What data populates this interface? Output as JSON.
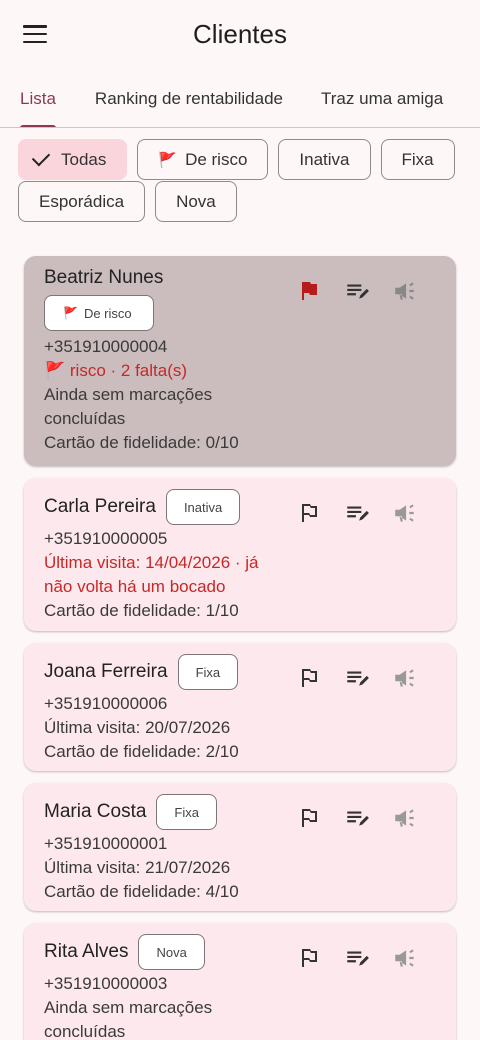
{
  "appbar": {
    "title": "Clientes"
  },
  "tabs": [
    {
      "label": "Lista"
    },
    {
      "label": "Ranking de rentabilidade"
    },
    {
      "label": "Traz uma amiga"
    }
  ],
  "filters": [
    {
      "label": "Todas",
      "selected": true
    },
    {
      "label": "De risco",
      "icon": "🚩"
    },
    {
      "label": "Inativa"
    },
    {
      "label": "Fixa"
    },
    {
      "label": "Esporádica"
    },
    {
      "label": "Nova"
    }
  ],
  "clients": [
    {
      "name": "Beatriz Nunes",
      "badge": "De risco",
      "badge_icon": "🚩",
      "phone": "+351910000004",
      "risk_line": "🚩 risco · 2 falta(s)",
      "visit": "Ainda sem marcações concluídas",
      "loyalty": "Cartão de fidelidade: 0/10",
      "flagged": true
    },
    {
      "name": "Carla Pereira",
      "badge": "Inativa",
      "phone": "+351910000005",
      "visit": "Última visita: 14/04/2026 · já não volta há um bocado",
      "loyalty": "Cartão de fidelidade: 1/10"
    },
    {
      "name": "Joana Ferreira",
      "badge": "Fixa",
      "phone": "+351910000006",
      "visit": "Última visita: 20/07/2026",
      "loyalty": "Cartão de fidelidade: 2/10"
    },
    {
      "name": "Maria Costa",
      "badge": "Fixa",
      "phone": "+351910000001",
      "visit": "Última visita: 21/07/2026",
      "loyalty": "Cartão de fidelidade: 4/10"
    },
    {
      "name": "Rita Alves",
      "badge": "Nova",
      "phone": "+351910000003",
      "visit": "Ainda sem marcações concluídas"
    }
  ],
  "colors": {
    "accent": "#8b3a52",
    "risk": "#c62828",
    "card": "#fde9ed",
    "card_highlight": "#cbbcbe"
  }
}
